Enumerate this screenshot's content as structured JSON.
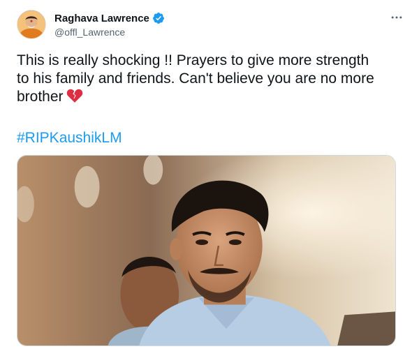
{
  "tweet": {
    "author": {
      "display_name": "Raghava Lawrence",
      "handle": "@offl_Lawrence",
      "verified": true,
      "avatar_icon": "profile-photo"
    },
    "more_icon": "more-horizontal-icon",
    "text": "This is really shocking !! Prayers to give more strength\nto his family and friends. Can't believe you are no more\nbrother",
    "emoji": "broken-heart",
    "hashtag": "#RIPKaushikLM",
    "media": {
      "kind": "photo",
      "description_icon": "photo-of-man"
    }
  },
  "colors": {
    "link": "#1d9bf0",
    "verified": "#1d9bf0",
    "secondary_text": "#536471",
    "border": "#cfd9de"
  }
}
